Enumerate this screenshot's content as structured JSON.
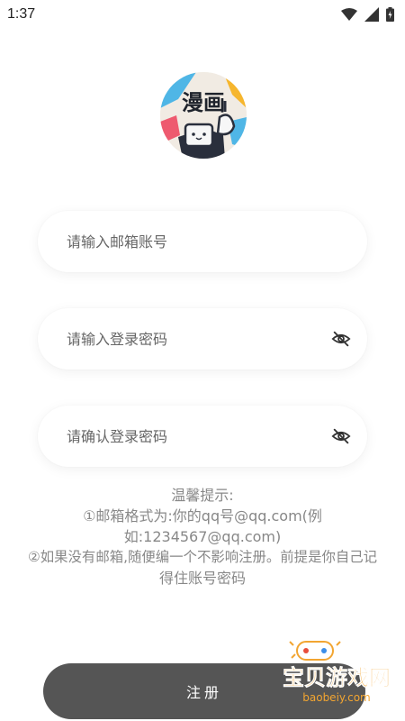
{
  "status_bar": {
    "time": "1:37"
  },
  "logo": {
    "text": "漫画"
  },
  "fields": {
    "email_placeholder": "请输入邮箱账号",
    "password_placeholder": "请输入登录密码",
    "confirm_placeholder": "请确认登录密码"
  },
  "tips": {
    "title": "温馨提示:",
    "line1": "①邮箱格式为:你的qq号@qq.com(例",
    "line2": "如:1234567@qq.com)",
    "line3": "②如果没有邮箱,随便编一个不影响注册。前提是你自己记",
    "line4": "得住账号密码"
  },
  "register_button": {
    "label": "注册"
  },
  "watermark": {
    "title": "宝贝游戏网",
    "url": "baobeiy.com"
  },
  "colors": {
    "button_bg": "#555555",
    "tips_text": "#888888",
    "page_bg": "#ffffff"
  }
}
